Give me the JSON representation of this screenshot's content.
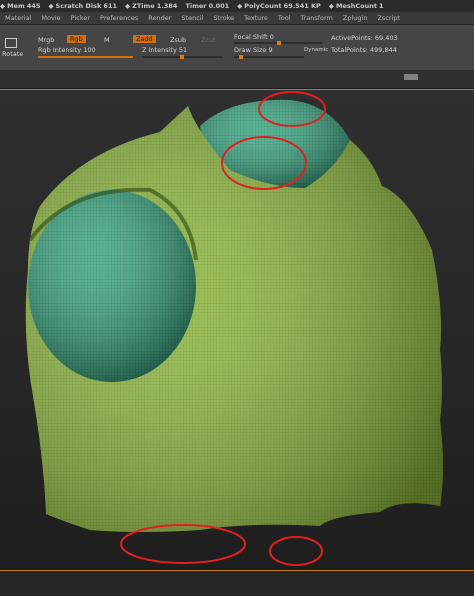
{
  "status_bar": {
    "mem_label": "Mem",
    "mem_value": "445",
    "scratch_label": "Scratch Disk",
    "scratch_value": "611",
    "ztime_label": "ZTime",
    "ztime_value": "1.384",
    "timer_label": "Timer",
    "timer_value": "0.001",
    "polycount_label": "PolyCount",
    "polycount_value": "69.541 KP",
    "meshcount_label": "MeshCount",
    "meshcount_value": "1"
  },
  "menu": [
    "Material",
    "Movie",
    "Picker",
    "Preferences",
    "Render",
    "Stencil",
    "Stroke",
    "Texture",
    "Tool",
    "Transform",
    "Zplugin",
    "Zscript"
  ],
  "toolbar": {
    "rotate_label": "Rotate",
    "mrgb_label": "Mrgb",
    "rgb_label": "Rgb",
    "m_label": "M",
    "zadd_label": "Zadd",
    "zsub_label": "Zsub",
    "zcut_label": "Zcut",
    "rgb_intensity_label": "Rgb  Intensity",
    "rgb_intensity_value": "100",
    "z_intensity_label": "Z  Intensity",
    "z_intensity_value": "51",
    "focal_shift_label": "Focal Shift",
    "focal_shift_value": "0",
    "draw_size_label": "Draw Size",
    "draw_size_value": "9",
    "dynamic_label": "Dynamic",
    "active_points_label": "ActivePoints:",
    "active_points_value": "69,403",
    "total_points_label": "TotalPoints:",
    "total_points_value": "499,844"
  },
  "colors": {
    "accent": "#d46e14",
    "mesh_green": "#8fb840",
    "mesh_teal": "#38a87e",
    "annotation_red": "#e02020"
  }
}
